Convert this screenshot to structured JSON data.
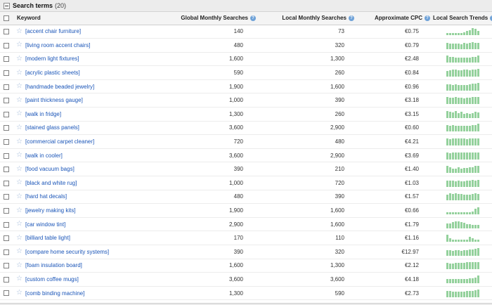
{
  "section": {
    "title": "Search terms",
    "count": "(20)"
  },
  "headers": {
    "keyword": "Keyword",
    "global": "Global Monthly Searches",
    "local": "Local Monthly Searches",
    "cpc": "Approximate CPC",
    "trends": "Local Search Trends"
  },
  "help_icon": "?",
  "star_icon": "☆",
  "colors": {
    "link": "#1a55b8",
    "trend_bar": "#94d19c",
    "help": "#6fa2d8"
  },
  "rows": [
    {
      "keyword": "[accent chair furniture]",
      "global": "140",
      "local": "73",
      "cpc": "€0.75",
      "trend": [
        0.25,
        0.25,
        0.25,
        0.3,
        0.3,
        0.3,
        0.4,
        0.55,
        0.6,
        0.95,
        0.8,
        0.5
      ]
    },
    {
      "keyword": "[living room accent chairs]",
      "global": "480",
      "local": "320",
      "cpc": "€0.79",
      "trend": [
        0.85,
        0.75,
        0.7,
        0.7,
        0.7,
        0.65,
        0.8,
        0.75,
        0.85,
        0.95,
        0.85,
        0.8
      ]
    },
    {
      "keyword": "[modern light fixtures]",
      "global": "1,600",
      "local": "1,300",
      "cpc": "€2.48",
      "trend": [
        0.9,
        0.75,
        0.7,
        0.65,
        0.65,
        0.6,
        0.6,
        0.6,
        0.65,
        0.7,
        0.75,
        0.95
      ]
    },
    {
      "keyword": "[acrylic plastic sheets]",
      "global": "590",
      "local": "260",
      "cpc": "€0.84",
      "trend": [
        0.7,
        0.8,
        0.9,
        0.9,
        0.8,
        0.85,
        0.9,
        0.9,
        0.8,
        0.9,
        0.95,
        1.0
      ]
    },
    {
      "keyword": "[handmade beaded jewelry]",
      "global": "1,900",
      "local": "1,600",
      "cpc": "€0.96",
      "trend": [
        0.85,
        0.8,
        0.75,
        0.8,
        0.75,
        0.75,
        0.7,
        0.75,
        0.8,
        0.9,
        0.9,
        1.0
      ]
    },
    {
      "keyword": "[paint thickness gauge]",
      "global": "1,000",
      "local": "390",
      "cpc": "€3.18",
      "trend": [
        0.9,
        0.85,
        0.85,
        0.9,
        0.85,
        0.8,
        0.7,
        0.85,
        0.85,
        0.95,
        0.9,
        0.95
      ]
    },
    {
      "keyword": "[walk in fridge]",
      "global": "1,300",
      "local": "260",
      "cpc": "€3.15",
      "trend": [
        0.95,
        0.85,
        0.75,
        0.9,
        0.6,
        0.85,
        0.55,
        0.6,
        0.55,
        0.65,
        0.8,
        0.75
      ]
    },
    {
      "keyword": "[stained glass panels]",
      "global": "3,600",
      "local": "2,900",
      "cpc": "€0.60",
      "trend": [
        0.85,
        0.75,
        0.8,
        0.75,
        0.75,
        0.7,
        0.7,
        0.75,
        0.75,
        0.8,
        0.85,
        1.0
      ]
    },
    {
      "keyword": "[commercial carpet cleaner]",
      "global": "720",
      "local": "480",
      "cpc": "€4.21",
      "trend": [
        0.9,
        0.85,
        0.95,
        0.9,
        0.9,
        0.9,
        0.9,
        0.85,
        0.95,
        0.95,
        0.9,
        0.95
      ]
    },
    {
      "keyword": "[walk in cooler]",
      "global": "3,600",
      "local": "2,900",
      "cpc": "€3.69",
      "trend": [
        0.9,
        0.85,
        0.9,
        0.95,
        0.95,
        0.95,
        0.95,
        0.9,
        0.9,
        0.9,
        0.9,
        0.95
      ]
    },
    {
      "keyword": "[food vacuum bags]",
      "global": "390",
      "local": "210",
      "cpc": "€1.40",
      "trend": [
        0.95,
        0.75,
        0.55,
        0.55,
        0.75,
        0.5,
        0.65,
        0.6,
        0.7,
        0.75,
        0.95,
        0.95
      ]
    },
    {
      "keyword": "[black and white rug]",
      "global": "1,000",
      "local": "720",
      "cpc": "€1.03",
      "trend": [
        0.85,
        0.85,
        0.8,
        0.75,
        0.8,
        0.75,
        0.75,
        0.8,
        0.85,
        0.9,
        0.85,
        0.9
      ]
    },
    {
      "keyword": "[hard hat decals]",
      "global": "480",
      "local": "390",
      "cpc": "€1.57",
      "trend": [
        0.75,
        0.9,
        0.85,
        0.9,
        0.85,
        0.8,
        0.75,
        0.75,
        0.7,
        0.8,
        0.9,
        0.85
      ]
    },
    {
      "keyword": "[jewelry making kits]",
      "global": "1,900",
      "local": "1,600",
      "cpc": "€0.66",
      "trend": [
        0.25,
        0.25,
        0.25,
        0.25,
        0.25,
        0.25,
        0.25,
        0.3,
        0.3,
        0.35,
        0.7,
        0.95
      ]
    },
    {
      "keyword": "[car window tint]",
      "global": "2,900",
      "local": "1,600",
      "cpc": "€1.79",
      "trend": [
        0.6,
        0.65,
        0.85,
        0.9,
        0.95,
        0.85,
        0.7,
        0.55,
        0.5,
        0.45,
        0.45,
        0.45
      ]
    },
    {
      "keyword": "[billiard table light]",
      "global": "170",
      "local": "110",
      "cpc": "€1.16",
      "trend": [
        0.95,
        0.45,
        0.25,
        0.25,
        0.25,
        0.25,
        0.25,
        0.3,
        0.6,
        0.45,
        0.3,
        0.3
      ]
    },
    {
      "keyword": "[compare home security systems]",
      "global": "390",
      "local": "320",
      "cpc": "€12.97",
      "trend": [
        0.75,
        0.7,
        0.65,
        0.7,
        0.7,
        0.65,
        0.7,
        0.75,
        0.8,
        0.85,
        0.9,
        1.0
      ]
    },
    {
      "keyword": "[foam insulation board]",
      "global": "1,600",
      "local": "1,300",
      "cpc": "€2.12",
      "trend": [
        0.8,
        0.75,
        0.75,
        0.8,
        0.85,
        0.8,
        0.85,
        0.9,
        0.95,
        0.95,
        0.9,
        0.95
      ]
    },
    {
      "keyword": "[custom coffee mugs]",
      "global": "3,600",
      "local": "3,600",
      "cpc": "€4.18",
      "trend": [
        0.55,
        0.5,
        0.5,
        0.5,
        0.5,
        0.5,
        0.55,
        0.55,
        0.6,
        0.65,
        0.75,
        1.0
      ]
    },
    {
      "keyword": "[comb binding machine]",
      "global": "1,300",
      "local": "590",
      "cpc": "€2.73",
      "trend": [
        0.85,
        0.8,
        0.75,
        0.75,
        0.7,
        0.7,
        0.75,
        0.8,
        0.85,
        0.85,
        0.9,
        1.0
      ]
    }
  ]
}
